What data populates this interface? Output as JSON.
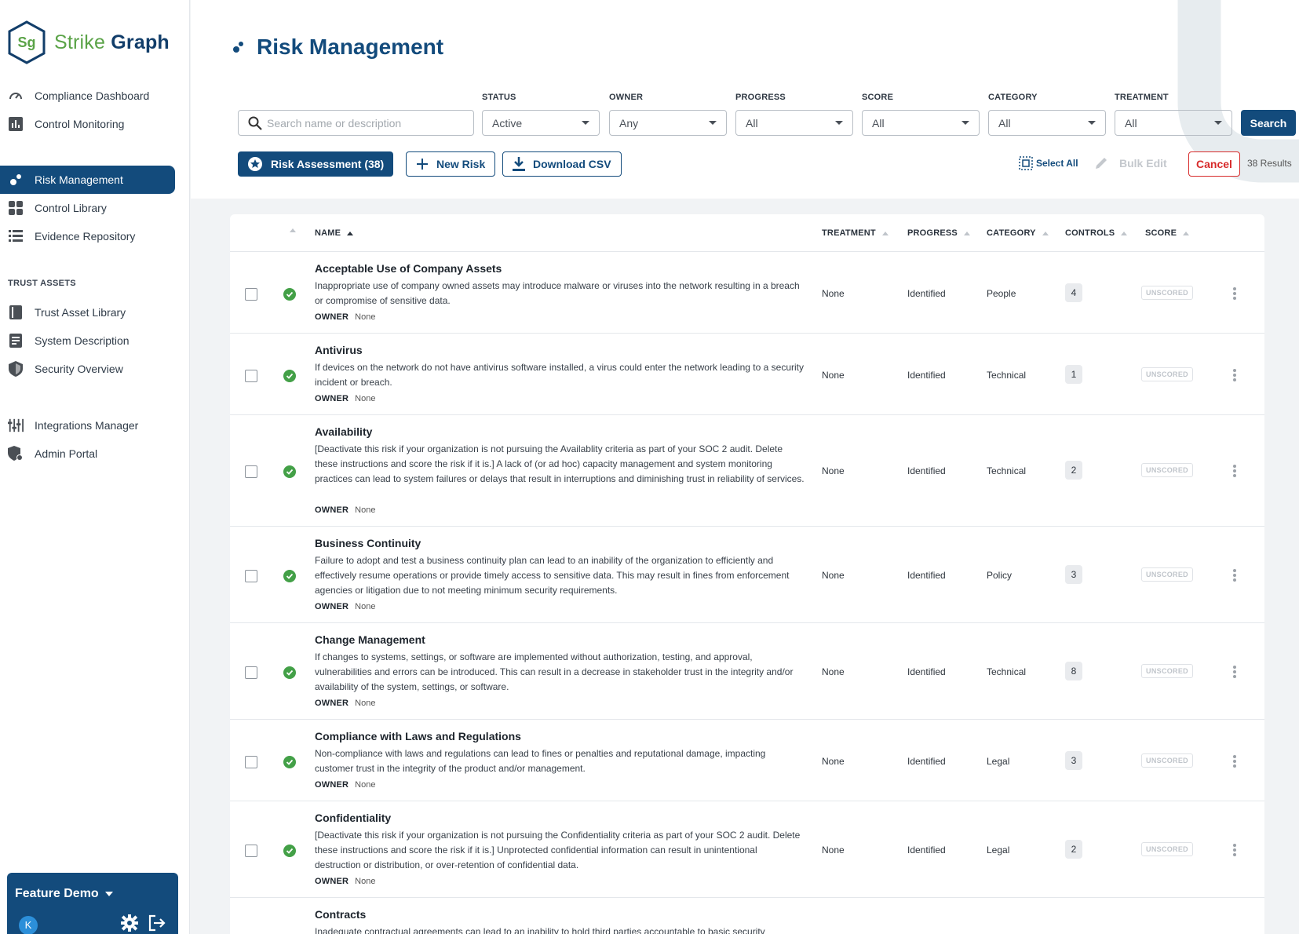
{
  "brand": {
    "mark": "Sg",
    "word1": "Strike",
    "word2": "Graph"
  },
  "nav": {
    "main": [
      {
        "label": "Compliance Dashboard",
        "icon": "gauge-icon"
      },
      {
        "label": "Control Monitoring",
        "icon": "bar-chart-icon"
      }
    ],
    "work": [
      {
        "label": "Risk Management",
        "icon": "risk-icon",
        "active": true
      },
      {
        "label": "Control Library",
        "icon": "grid-icon"
      },
      {
        "label": "Evidence Repository",
        "icon": "list-icon"
      }
    ],
    "trust_label": "TRUST ASSETS",
    "trust": [
      {
        "label": "Trust Asset Library",
        "icon": "book-icon"
      },
      {
        "label": "System Description",
        "icon": "document-icon"
      },
      {
        "label": "Security Overview",
        "icon": "shield-icon"
      }
    ],
    "admin": [
      {
        "label": "Integrations Manager",
        "icon": "sliders-icon"
      },
      {
        "label": "Admin Portal",
        "icon": "admin-shield-icon"
      }
    ]
  },
  "org": {
    "name": "Feature Demo",
    "avatar": "K"
  },
  "page": {
    "title": "Risk Management"
  },
  "search": {
    "placeholder": "Search name or description",
    "button": "Search"
  },
  "filters": [
    {
      "label": "STATUS",
      "value": "Active"
    },
    {
      "label": "OWNER",
      "value": "Any"
    },
    {
      "label": "PROGRESS",
      "value": "All"
    },
    {
      "label": "SCORE",
      "value": "All"
    },
    {
      "label": "CATEGORY",
      "value": "All"
    },
    {
      "label": "TREATMENT",
      "value": "All"
    }
  ],
  "actions": {
    "risk_assessment": "Risk Assessment (38)",
    "new_risk": "New Risk",
    "download_csv": "Download CSV",
    "select_all": "Select All",
    "bulk_edit": "Bulk Edit",
    "cancel": "Cancel",
    "results": "38 Results"
  },
  "table": {
    "headers": {
      "name": "NAME",
      "treatment": "TREATMENT",
      "progress": "PROGRESS",
      "category": "CATEGORY",
      "controls": "CONTROLS",
      "score": "SCORE"
    },
    "owner_label": "OWNER",
    "rows": [
      {
        "name": "Acceptable Use of Company Assets",
        "desc": "Inappropriate use of company owned assets may introduce malware or viruses into the network resulting in a breach or compromise of sensitive data.",
        "owner": "None",
        "treatment": "None",
        "progress": "Identified",
        "category": "People",
        "controls": "4",
        "score": "UNSCORED"
      },
      {
        "name": "Antivirus",
        "desc": "If devices on the network do not have antivirus software installed, a virus could enter the network leading to a security incident or breach.",
        "owner": "None",
        "treatment": "None",
        "progress": "Identified",
        "category": "Technical",
        "controls": "1",
        "score": "UNSCORED"
      },
      {
        "name": "Availability",
        "desc": "[Deactivate this risk if your organization is not pursuing the Availablity criteria as part of your SOC 2 audit. Delete these instructions and score the risk if it is.] A lack of (or ad hoc) capacity management and system monitoring practices can lead to system failures or delays that result in interruptions and diminishing trust in reliability of services.",
        "owner": "None",
        "treatment": "None",
        "progress": "Identified",
        "category": "Technical",
        "controls": "2",
        "score": "UNSCORED"
      },
      {
        "name": "Business Continuity",
        "desc": "Failure to adopt and test a business continuity plan can lead to an inability of the organization to efficiently and effectively resume operations or provide timely access to sensitive data. This may result in fines from enforcement agencies or litigation due to not meeting minimum security requirements.",
        "owner": "None",
        "treatment": "None",
        "progress": "Identified",
        "category": "Policy",
        "controls": "3",
        "score": "UNSCORED"
      },
      {
        "name": "Change Management",
        "desc": "If changes to systems, settings, or software are implemented without authorization, testing, and approval, vulnerabilities and errors can be introduced. This can result in a decrease in stakeholder trust in the integrity and/or availability of the system, settings, or software.",
        "owner": "None",
        "treatment": "None",
        "progress": "Identified",
        "category": "Technical",
        "controls": "8",
        "score": "UNSCORED"
      },
      {
        "name": "Compliance with Laws and Regulations",
        "desc": "Non-compliance with laws and regulations can lead to fines or penalties and reputational damage, impacting customer trust in the integrity of the product and/or management.",
        "owner": "None",
        "treatment": "None",
        "progress": "Identified",
        "category": "Legal",
        "controls": "3",
        "score": "UNSCORED"
      },
      {
        "name": "Confidentiality",
        "desc": "[Deactivate this risk if your organization is not pursuing the Confidentiality criteria as part of your SOC 2 audit. Delete these instructions and score the risk if it is.] Unprotected confidential information can result in unintentional destruction or distribution, or over-retention of confidential data.",
        "owner": "None",
        "treatment": "None",
        "progress": "Identified",
        "category": "Legal",
        "controls": "2",
        "score": "UNSCORED"
      },
      {
        "name": "Contracts",
        "desc": "Inadequate contractual agreements can lead to an inability to hold third parties accountable to basic security",
        "owner": "",
        "treatment": "",
        "progress": "",
        "category": "",
        "controls": "",
        "score": ""
      }
    ]
  }
}
